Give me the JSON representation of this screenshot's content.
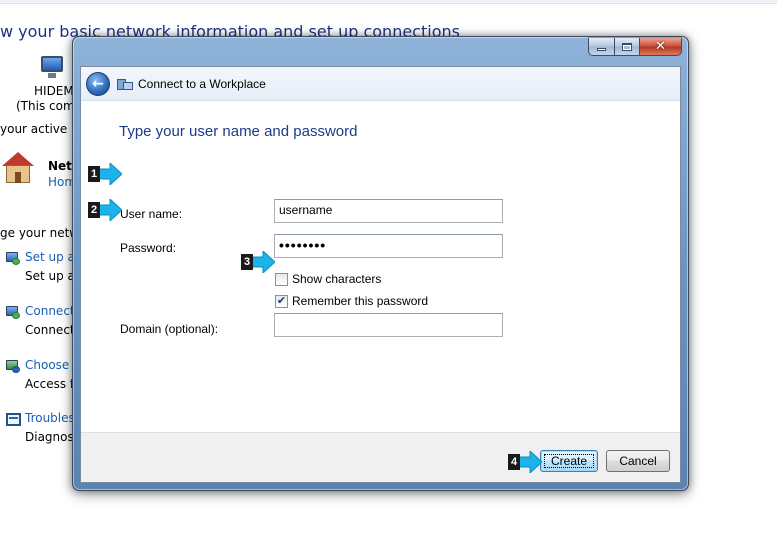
{
  "background": {
    "heading": "w your basic network information and set up connections",
    "computer_name": "HIDEM",
    "computer_sub": "(This comp",
    "active_networks": "your active ne",
    "network_name": "Netw",
    "network_type": "Hom",
    "change_settings": "ge your netwo",
    "tasks": [
      {
        "link": "Set up a n",
        "desc": "Set up a w"
      },
      {
        "link": "Connect",
        "desc": "Connect"
      },
      {
        "link": "Choose h",
        "desc": "Access fil"
      },
      {
        "link": "Troublesh",
        "desc": "Diagnose"
      }
    ]
  },
  "dialog": {
    "title": "Connect to a Workplace",
    "heading": "Type your user name and password",
    "fields": {
      "username": {
        "label": "User name:",
        "value": "username"
      },
      "password": {
        "label": "Password:",
        "value": "••••••••"
      },
      "domain": {
        "label": "Domain (optional):",
        "value": ""
      }
    },
    "checkboxes": {
      "show_characters": {
        "label": "Show characters",
        "checked": false
      },
      "remember_password": {
        "label": "Remember this password",
        "checked": true
      }
    },
    "buttons": {
      "create": "Create",
      "cancel": "Cancel"
    },
    "caption": {
      "close_glyph": "✕"
    }
  },
  "callouts": {
    "step1": "1",
    "step2": "2",
    "step3": "3",
    "step4": "4"
  },
  "colors": {
    "heading_blue": "#1e3a8a",
    "link_blue": "#1a5fb4",
    "callout_cyan": "#1bb3ea"
  },
  "icons": [
    "back-arrow-icon",
    "workplace-icon",
    "computer-icon",
    "home-network-icon",
    "network-task-icon",
    "troubleshoot-icon"
  ]
}
